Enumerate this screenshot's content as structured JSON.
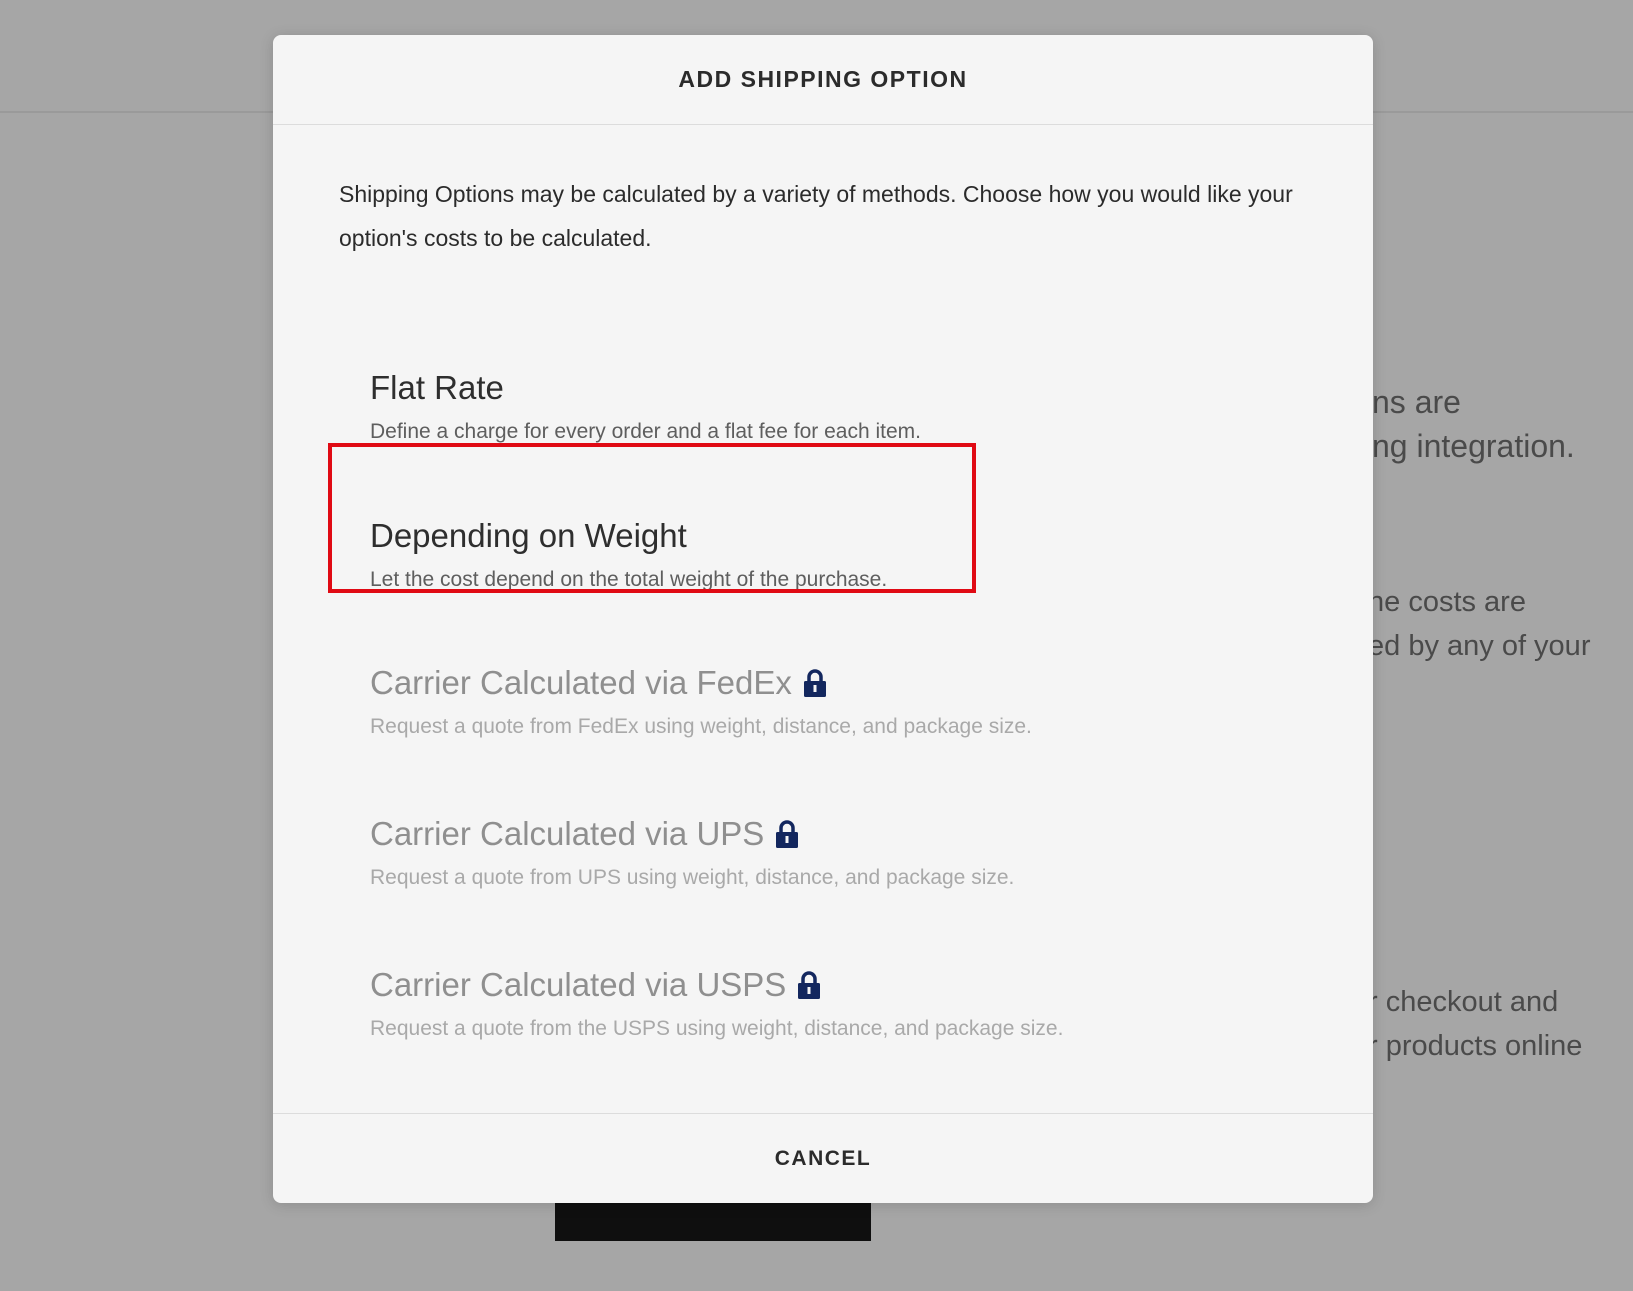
{
  "background": {
    "block1": [
      "ns are",
      "ng integration."
    ],
    "block2": [
      "ne costs are",
      "ed by any of your"
    ],
    "block3": [
      "r checkout and",
      "r products online"
    ]
  },
  "modal": {
    "title": "ADD SHIPPING OPTION",
    "intro": "Shipping Options may be calculated by a variety of methods. Choose how you would like your option's costs to be calculated.",
    "options": [
      {
        "title": "Flat Rate",
        "description": "Define a charge for every order and a flat fee for each item.",
        "locked": false
      },
      {
        "title": "Depending on Weight",
        "description": "Let the cost depend on the total weight of the purchase.",
        "locked": false,
        "highlighted": true
      },
      {
        "title": "Carrier Calculated via FedEx",
        "description": "Request a quote from FedEx using weight, distance, and package size.",
        "locked": true,
        "icon": "lock-icon"
      },
      {
        "title": "Carrier Calculated via UPS",
        "description": "Request a quote from UPS using weight, distance, and package size.",
        "locked": true,
        "icon": "lock-icon"
      },
      {
        "title": "Carrier Calculated via USPS",
        "description": "Request a quote from the USPS using weight, distance, and package size.",
        "locked": true,
        "icon": "lock-icon"
      }
    ],
    "cancel_label": "CANCEL"
  },
  "colors": {
    "highlight": "#e00a14",
    "lock": "#13275e",
    "overlay": "#a6a6a6"
  }
}
